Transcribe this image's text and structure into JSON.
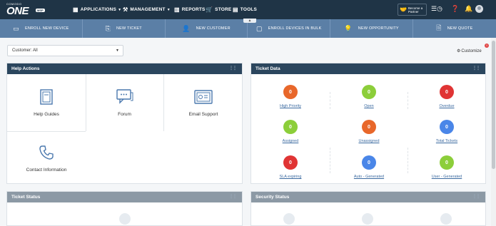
{
  "brand": {
    "small": "COMODO",
    "big": "ONE",
    "tag": "MSP"
  },
  "topnav": {
    "applications": "APPLICATIONS",
    "management": "MANAGEMENT",
    "reports": "REPORTS",
    "store": "STORE",
    "tools": "TOOLS",
    "partner_line1": "Become a",
    "partner_line2": "Partner"
  },
  "quick_actions": [
    {
      "label": "ENROLL NEW DEVICE",
      "icon": "monitor-icon"
    },
    {
      "label": "NEW TICKET",
      "icon": "ticket-icon"
    },
    {
      "label": "NEW CUSTOMER",
      "icon": "user-icon"
    },
    {
      "label": "ENROLL DEVICES IN BULK",
      "icon": "folder-icon"
    },
    {
      "label": "NEW OPPORTUNITY",
      "icon": "lightbulb-icon"
    },
    {
      "label": "NEW QUOTE",
      "icon": "document-icon"
    }
  ],
  "customer_select": {
    "value": "Customer: All"
  },
  "customize": {
    "label": "Customize",
    "badge": "!"
  },
  "help_actions": {
    "title": "Help Actions",
    "items": [
      {
        "label": "Help Guides",
        "icon": "book-icon"
      },
      {
        "label": "Forum",
        "icon": "chat-icon"
      },
      {
        "label": "Email Support",
        "icon": "email-icon"
      },
      {
        "label": "Contact Information",
        "icon": "phone-icon"
      }
    ]
  },
  "ticket_data": {
    "title": "Ticket Data",
    "items": [
      {
        "label": "High Priority",
        "value": "0",
        "color": "#e8672a"
      },
      {
        "label": "Open",
        "value": "0",
        "color": "#8cce3a"
      },
      {
        "label": "Overdue",
        "value": "0",
        "color": "#e03434"
      },
      {
        "label": "Assigned",
        "value": "0",
        "color": "#8cce3a"
      },
      {
        "label": "Unassigned",
        "value": "0",
        "color": "#e8672a"
      },
      {
        "label": "Total Tickets",
        "value": "0",
        "color": "#4a86e8"
      },
      {
        "label": "SLA expiring",
        "value": "0",
        "color": "#e03434"
      },
      {
        "label": "Auto - Generated",
        "value": "0",
        "color": "#4a86e8"
      },
      {
        "label": "User - Generated",
        "value": "0",
        "color": "#8cce3a"
      }
    ]
  },
  "ticket_status": {
    "title": "Ticket Status"
  },
  "security_status": {
    "title": "Security Status"
  }
}
